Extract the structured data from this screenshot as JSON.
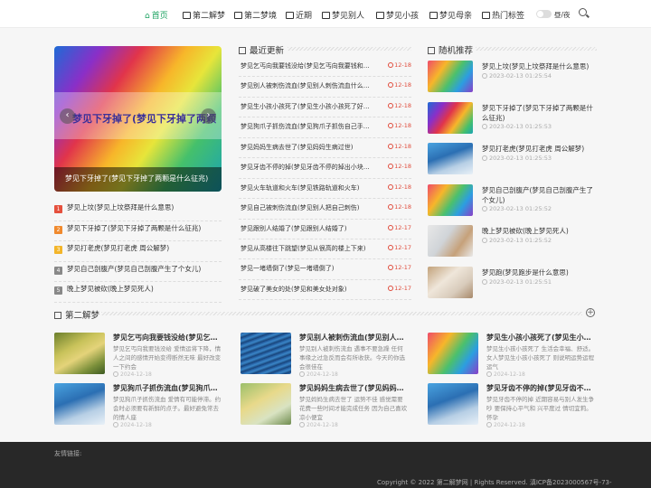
{
  "nav": {
    "items": [
      {
        "label": "首页",
        "active": true
      },
      {
        "label": "第二解梦"
      },
      {
        "label": "第二梦境"
      },
      {
        "label": "近期"
      },
      {
        "label": "梦见别人"
      },
      {
        "label": "梦见小孩"
      },
      {
        "label": "梦见母亲"
      },
      {
        "label": "热门标签"
      }
    ],
    "theme_label": "昼/夜"
  },
  "slider": {
    "title": "梦见下牙掉了(梦见下牙掉了两颗",
    "caption": "梦见下牙掉了(梦见下牙掉了两颗是什么征兆)"
  },
  "left_list": [
    {
      "rank": "1",
      "color": "#e5503d",
      "title": "梦见上坟(梦见上坟祭拜是什么意思)"
    },
    {
      "rank": "2",
      "color": "#f08a2e",
      "title": "梦见下牙掉了(梦见下牙掉了两颗是什么征兆)"
    },
    {
      "rank": "3",
      "color": "#f3b52a",
      "title": "梦见打老虎(梦见打老虎 周公解梦)"
    },
    {
      "rank": "4",
      "color": "#888888",
      "title": "梦见自己剖腹产(梦见自己剖腹产生了个女儿)"
    },
    {
      "rank": "5",
      "color": "#888888",
      "title": "晚上梦见被砍(晚上梦见死人)"
    }
  ],
  "latest": {
    "heading": "最近更新",
    "items": [
      {
        "title": "梦见乞丐向我要钱没给(梦见乞丐向我要钱和…",
        "date": "12-18"
      },
      {
        "title": "梦见别人被刺伤流血(梦见别人刺伤流血什么…",
        "date": "12-18"
      },
      {
        "title": "梦见生小孩小孩死了(梦见生小孩小孩死了好…",
        "date": "12-18"
      },
      {
        "title": "梦见狗爪子抓伤流血(梦见狗爪子抓伤自己手…",
        "date": "12-18"
      },
      {
        "title": "梦见妈妈生病去世了(梦见妈妈生病过世)",
        "date": "12-18"
      },
      {
        "title": "梦见牙齿不停的掉(梦见牙齿不停的掉出小块…",
        "date": "12-18"
      },
      {
        "title": "梦见火车轨道和火车(梦见铁路轨道和火车)",
        "date": "12-18"
      },
      {
        "title": "梦见自己被刺伤流血(梦见别人把自己刺伤)",
        "date": "12-18"
      },
      {
        "title": "梦见跟别人结婚了(梦见跟别人结婚了)",
        "date": "12-17"
      },
      {
        "title": "梦见从高楼往下跳望(梦见从很高的楼上下来)",
        "date": "12-17"
      },
      {
        "title": "梦见一堵墙倒了(梦见一堵墙倒了)",
        "date": "12-17"
      },
      {
        "title": "梦见破了美女的处(梦见和美女处对象)",
        "date": "12-17"
      }
    ]
  },
  "random": {
    "heading": "随机推荐",
    "items": [
      {
        "title": "梦见上坟(梦见上坟祭拜是什么意思)",
        "date": "2023-02-13 01:25:54"
      },
      {
        "title": "梦见下牙掉了(梦见下牙掉了两颗是什么征兆)",
        "date": "2023-02-13 01:25:53"
      },
      {
        "title": "梦见打老虎(梦见打老虎 周公解梦)",
        "date": "2023-02-13 01:25:53"
      },
      {
        "title": "梦见自己剖腹产(梦见自己剖腹产生了个女儿)",
        "date": "2023-02-13 01:25:52"
      },
      {
        "title": "晚上梦见被砍(晚上梦见死人)",
        "date": "2023-02-13 01:25:52"
      },
      {
        "title": "梦见跑(梦见跑步是什么意思)",
        "date": "2023-02-13 01:25:51"
      }
    ]
  },
  "section2": {
    "heading": "第二解梦",
    "plus": "+",
    "cards": [
      {
        "title": "梦见乞丐向我要钱没给(梦见乞丐向我…",
        "excerpt": "梦见乞丐向我要钱没给 爱情运将下降，情人之间的感情开始变得断然无味 最好改变一下约会",
        "date": "2024-12-18"
      },
      {
        "title": "梦见别人被刺伤流血(梦见别人刺伤…",
        "excerpt": "梦见别人被刺伤流血 遇事不要急躁 任何事缘之过急反而会有所收获。今天的你选会很佳在",
        "date": "2024-12-18"
      },
      {
        "title": "梦见生小孩小孩死了(梦见生小孩小…",
        "excerpt": "梦见生小孩小孩死了 生活会幸福、舒适。女人梦见生小孩小孩死了 则说明运势运程 运气",
        "date": "2024-12-18"
      },
      {
        "title": "梦见狗爪子抓伤流血(梦见狗爪子抓…",
        "excerpt": "梦见狗爪子抓伤流血 爱情有可能停滞。约会时必须要有新鲜的点子。最好避免常去的情人座",
        "date": "2024-12-18"
      },
      {
        "title": "梦见妈妈生病去世了(梦见妈妈生病…",
        "excerpt": "梦见妈妈生病去世了 运势不佳 感觉需要花费一些时间才能完成任务 因为自己喜欢凉小便宜",
        "date": "2024-12-18"
      },
      {
        "title": "梦见牙齿不停的掉(梦见牙齿不停的…",
        "excerpt": "梦见牙齿不停的掉 近期容易与别人发生争吵 要保持心平气和 兴平度过 情切宜莉。 怀孕",
        "date": "2024-12-18"
      }
    ]
  },
  "footer": {
    "links_label": "友情链接:",
    "copyright": "Copyright © 2022 第二解梦网 | Rights Reserved.  滇ICP备2023000567号-73-"
  }
}
